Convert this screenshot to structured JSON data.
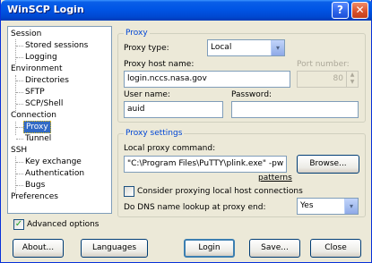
{
  "window": {
    "title": "WinSCP Login",
    "help_glyph": "?",
    "close_glyph": "✕"
  },
  "tree": {
    "session": "Session",
    "stored_sessions": "Stored sessions",
    "logging": "Logging",
    "environment": "Environment",
    "directories": "Directories",
    "sftp": "SFTP",
    "scp_shell": "SCP/Shell",
    "connection": "Connection",
    "proxy": "Proxy",
    "tunnel": "Tunnel",
    "ssh": "SSH",
    "key_exchange": "Key exchange",
    "authentication": "Authentication",
    "bugs": "Bugs",
    "preferences": "Preferences"
  },
  "proxy": {
    "group_title": "Proxy",
    "type_label": "Proxy type:",
    "type_value": "Local",
    "host_label": "Proxy host name:",
    "host_value": "login.nccs.nasa.gov",
    "port_label": "Port number:",
    "port_value": "80",
    "user_label": "User name:",
    "user_value": "auid",
    "password_label": "Password:",
    "password_value": ""
  },
  "proxy_settings": {
    "group_title": "Proxy settings",
    "command_label": "Local proxy command:",
    "command_value": "\"C:\\Program Files\\PuTTY\\plink.exe\" -pw %",
    "browse_label": "Browse...",
    "patterns_label": "patterns",
    "consider_label": "Consider proxying local host connections",
    "consider_checked": false,
    "dns_label": "Do DNS name lookup at proxy end:",
    "dns_value": "Yes"
  },
  "advanced": {
    "label": "Advanced options",
    "checked": true
  },
  "buttons": {
    "about": "About...",
    "languages": "Languages",
    "login": "Login",
    "save": "Save...",
    "close": "Close"
  },
  "icons": {
    "dropdown": "▾",
    "check": "✓",
    "spin_up": "▲",
    "spin_down": "▼"
  }
}
